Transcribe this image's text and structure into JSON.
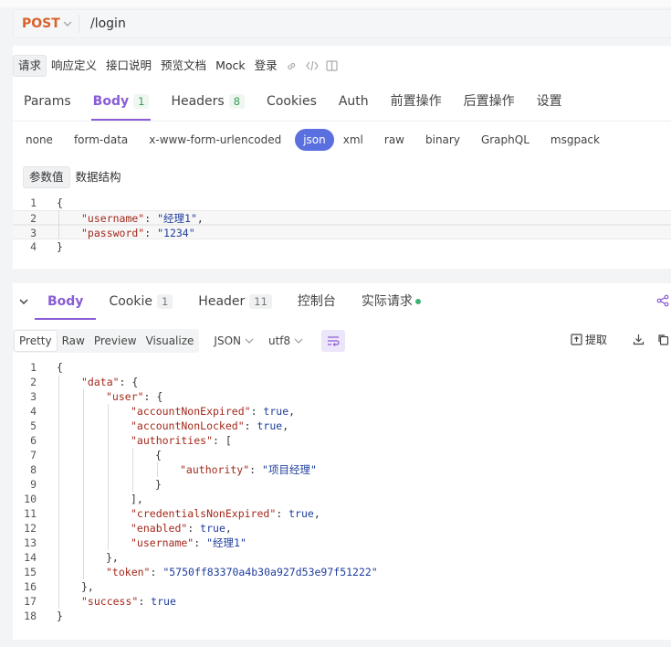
{
  "request": {
    "method": "POST",
    "url": "/login",
    "subtabs": [
      "请求",
      "响应定义",
      "接口说明",
      "预览文档",
      "Mock",
      "登录"
    ],
    "tabs": [
      {
        "label": "Params",
        "count": ""
      },
      {
        "label": "Body",
        "count": "1"
      },
      {
        "label": "Headers",
        "count": "8"
      },
      {
        "label": "Cookies",
        "count": ""
      },
      {
        "label": "Auth",
        "count": ""
      },
      {
        "label": "前置操作",
        "count": ""
      },
      {
        "label": "后置操作",
        "count": ""
      },
      {
        "label": "设置",
        "count": ""
      }
    ],
    "body_types": [
      "none",
      "form-data",
      "x-www-form-urlencoded",
      "json",
      "xml",
      "raw",
      "binary",
      "GraphQL",
      "msgpack"
    ],
    "param_tabs": [
      "参数值",
      "数据结构"
    ],
    "code_lines": [
      {
        "n": "1",
        "indent": 0,
        "parts": [
          [
            "p",
            "{"
          ]
        ]
      },
      {
        "n": "2",
        "indent": 1,
        "parts": [
          [
            "k",
            "\"username\""
          ],
          [
            "p",
            ": "
          ],
          [
            "s",
            "\"经理1\""
          ],
          [
            "p",
            ","
          ]
        ]
      },
      {
        "n": "3",
        "indent": 1,
        "parts": [
          [
            "k",
            "\"password\""
          ],
          [
            "p",
            ": "
          ],
          [
            "s",
            "\"1234\""
          ]
        ]
      },
      {
        "n": "4",
        "indent": 0,
        "parts": [
          [
            "p",
            "}"
          ]
        ]
      }
    ]
  },
  "response": {
    "tabs": [
      {
        "label": "Body",
        "count": ""
      },
      {
        "label": "Cookie",
        "count": "1"
      },
      {
        "label": "Header",
        "count": "11"
      },
      {
        "label": "控制台",
        "count": ""
      },
      {
        "label": "实际请求",
        "count": ""
      }
    ],
    "view_modes": [
      "Pretty",
      "Raw",
      "Preview",
      "Visualize"
    ],
    "format": "JSON",
    "encoding": "utf8",
    "extract_label": "提取",
    "code_lines": [
      {
        "n": "1",
        "indent": 0,
        "parts": [
          [
            "p",
            "{"
          ]
        ]
      },
      {
        "n": "2",
        "indent": 1,
        "parts": [
          [
            "k",
            "\"data\""
          ],
          [
            "p",
            ": {"
          ]
        ]
      },
      {
        "n": "3",
        "indent": 2,
        "parts": [
          [
            "k",
            "\"user\""
          ],
          [
            "p",
            ": {"
          ]
        ]
      },
      {
        "n": "4",
        "indent": 3,
        "parts": [
          [
            "k",
            "\"accountNonExpired\""
          ],
          [
            "p",
            ": "
          ],
          [
            "b",
            "true"
          ],
          [
            "p",
            ","
          ]
        ]
      },
      {
        "n": "5",
        "indent": 3,
        "parts": [
          [
            "k",
            "\"accountNonLocked\""
          ],
          [
            "p",
            ": "
          ],
          [
            "b",
            "true"
          ],
          [
            "p",
            ","
          ]
        ]
      },
      {
        "n": "6",
        "indent": 3,
        "parts": [
          [
            "k",
            "\"authorities\""
          ],
          [
            "p",
            ": ["
          ]
        ]
      },
      {
        "n": "7",
        "indent": 4,
        "parts": [
          [
            "p",
            "{"
          ]
        ]
      },
      {
        "n": "8",
        "indent": 5,
        "parts": [
          [
            "k",
            "\"authority\""
          ],
          [
            "p",
            ": "
          ],
          [
            "s",
            "\"项目经理\""
          ]
        ]
      },
      {
        "n": "9",
        "indent": 4,
        "parts": [
          [
            "p",
            "}"
          ]
        ]
      },
      {
        "n": "10",
        "indent": 3,
        "parts": [
          [
            "p",
            "],"
          ]
        ]
      },
      {
        "n": "11",
        "indent": 3,
        "parts": [
          [
            "k",
            "\"credentialsNonExpired\""
          ],
          [
            "p",
            ": "
          ],
          [
            "b",
            "true"
          ],
          [
            "p",
            ","
          ]
        ]
      },
      {
        "n": "12",
        "indent": 3,
        "parts": [
          [
            "k",
            "\"enabled\""
          ],
          [
            "p",
            ": "
          ],
          [
            "b",
            "true"
          ],
          [
            "p",
            ","
          ]
        ]
      },
      {
        "n": "13",
        "indent": 3,
        "parts": [
          [
            "k",
            "\"username\""
          ],
          [
            "p",
            ": "
          ],
          [
            "s",
            "\"经理1\""
          ]
        ]
      },
      {
        "n": "14",
        "indent": 2,
        "parts": [
          [
            "p",
            "},"
          ]
        ]
      },
      {
        "n": "15",
        "indent": 2,
        "parts": [
          [
            "k",
            "\"token\""
          ],
          [
            "p",
            ": "
          ],
          [
            "s",
            "\"5750ff83370a4b30a927d53e97f51222\""
          ]
        ]
      },
      {
        "n": "16",
        "indent": 1,
        "parts": [
          [
            "p",
            "},"
          ]
        ]
      },
      {
        "n": "17",
        "indent": 1,
        "parts": [
          [
            "k",
            "\"success\""
          ],
          [
            "p",
            ": "
          ],
          [
            "b",
            "true"
          ]
        ]
      },
      {
        "n": "18",
        "indent": 0,
        "parts": [
          [
            "p",
            "}"
          ]
        ]
      }
    ]
  },
  "colors": {
    "accent": "#8a5cd6",
    "method": "#d9622b",
    "json_pill": "#5a6fe0",
    "count_green": "#3a9a5c"
  },
  "icons": [
    "chevron-down-icon",
    "link-icon",
    "code-icon",
    "split-view-icon",
    "collapse-chevron-icon",
    "share-icon",
    "wrap-icon",
    "extract-icon",
    "download-icon",
    "copy-icon"
  ]
}
